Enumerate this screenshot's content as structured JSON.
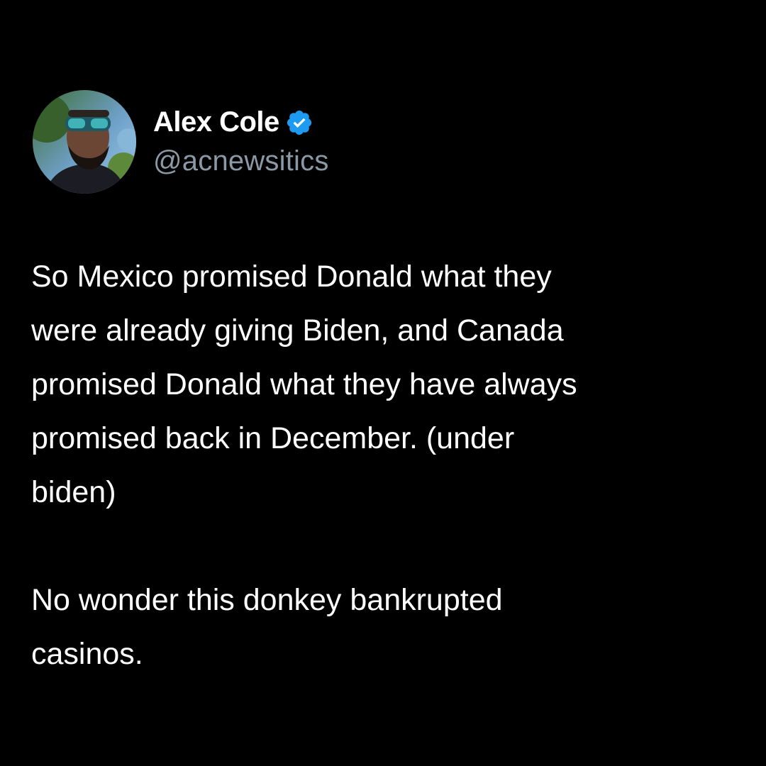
{
  "post": {
    "author": {
      "display_name": "Alex Cole",
      "handle": "@acnewsitics",
      "verified": true,
      "avatar": "profile-photo",
      "verified_icon": "verified-badge-icon"
    },
    "text_lines": [
      "So Mexico promised Donald what they",
      "were already giving Biden, and Canada",
      "promised Donald what they have always",
      "promised back in December. (under",
      "biden)",
      "",
      "No wonder this donkey bankrupted",
      "casinos."
    ]
  },
  "colors": {
    "background": "#000000",
    "text": "#ffffff",
    "handle": "#8b98a5",
    "verified": "#1d9bf0"
  }
}
